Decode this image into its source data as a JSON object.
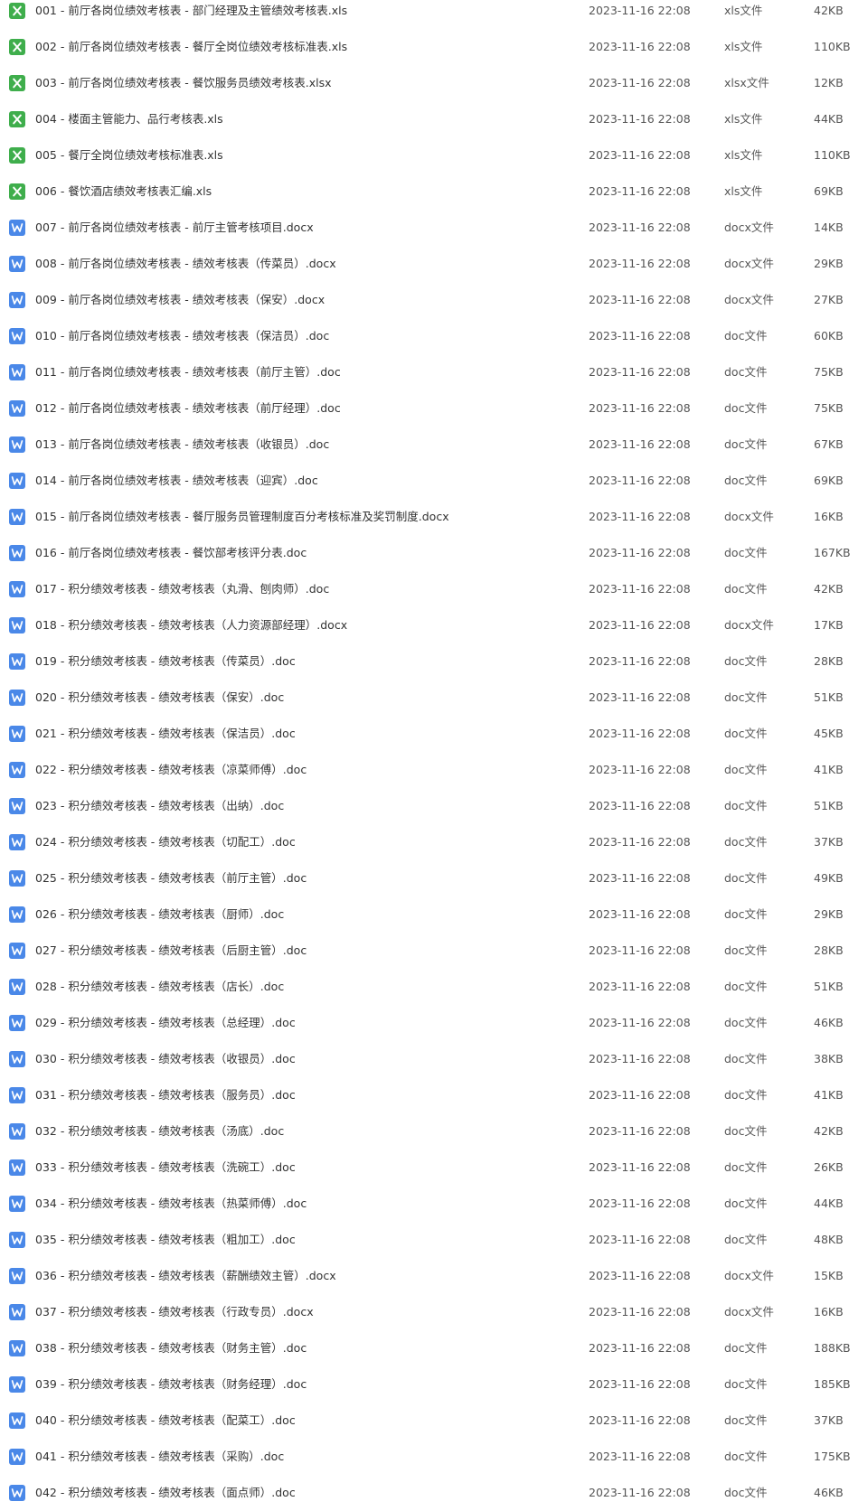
{
  "colors": {
    "xls_icon": "#3fae4c",
    "doc_icon": "#4a88e8",
    "text": "#333333",
    "background": "#ffffff"
  },
  "icons": {
    "xls": "excel-file-icon",
    "doc": "word-file-icon"
  },
  "files": [
    {
      "name": "001 - 前厅各岗位绩效考核表 - 部门经理及主管绩效考核表.xls",
      "date": "2023-11-16 22:08",
      "type": "xls文件",
      "size": "42KB",
      "icon": "xls"
    },
    {
      "name": "002 - 前厅各岗位绩效考核表 - 餐厅全岗位绩效考核标准表.xls",
      "date": "2023-11-16 22:08",
      "type": "xls文件",
      "size": "110KB",
      "icon": "xls"
    },
    {
      "name": "003 - 前厅各岗位绩效考核表 - 餐饮服务员绩效考核表.xlsx",
      "date": "2023-11-16 22:08",
      "type": "xlsx文件",
      "size": "12KB",
      "icon": "xls"
    },
    {
      "name": "004 - 楼面主管能力、品行考核表.xls",
      "date": "2023-11-16 22:08",
      "type": "xls文件",
      "size": "44KB",
      "icon": "xls"
    },
    {
      "name": "005 - 餐厅全岗位绩效考核标准表.xls",
      "date": "2023-11-16 22:08",
      "type": "xls文件",
      "size": "110KB",
      "icon": "xls"
    },
    {
      "name": "006 - 餐饮酒店绩效考核表汇编.xls",
      "date": "2023-11-16 22:08",
      "type": "xls文件",
      "size": "69KB",
      "icon": "xls"
    },
    {
      "name": "007 - 前厅各岗位绩效考核表 - 前厅主管考核项目.docx",
      "date": "2023-11-16 22:08",
      "type": "docx文件",
      "size": "14KB",
      "icon": "doc"
    },
    {
      "name": "008 - 前厅各岗位绩效考核表 - 绩效考核表（传菜员）.docx",
      "date": "2023-11-16 22:08",
      "type": "docx文件",
      "size": "29KB",
      "icon": "doc"
    },
    {
      "name": "009 - 前厅各岗位绩效考核表 - 绩效考核表（保安）.docx",
      "date": "2023-11-16 22:08",
      "type": "docx文件",
      "size": "27KB",
      "icon": "doc"
    },
    {
      "name": "010 - 前厅各岗位绩效考核表 - 绩效考核表（保洁员）.doc",
      "date": "2023-11-16 22:08",
      "type": "doc文件",
      "size": "60KB",
      "icon": "doc"
    },
    {
      "name": "011 - 前厅各岗位绩效考核表 - 绩效考核表（前厅主管）.doc",
      "date": "2023-11-16 22:08",
      "type": "doc文件",
      "size": "75KB",
      "icon": "doc"
    },
    {
      "name": "012 - 前厅各岗位绩效考核表 - 绩效考核表（前厅经理）.doc",
      "date": "2023-11-16 22:08",
      "type": "doc文件",
      "size": "75KB",
      "icon": "doc"
    },
    {
      "name": "013 - 前厅各岗位绩效考核表 - 绩效考核表（收银员）.doc",
      "date": "2023-11-16 22:08",
      "type": "doc文件",
      "size": "67KB",
      "icon": "doc"
    },
    {
      "name": "014 - 前厅各岗位绩效考核表 - 绩效考核表（迎宾）.doc",
      "date": "2023-11-16 22:08",
      "type": "doc文件",
      "size": "69KB",
      "icon": "doc"
    },
    {
      "name": "015 - 前厅各岗位绩效考核表 - 餐厅服务员管理制度百分考核标准及奖罚制度.docx",
      "date": "2023-11-16 22:08",
      "type": "docx文件",
      "size": "16KB",
      "icon": "doc"
    },
    {
      "name": "016 - 前厅各岗位绩效考核表 - 餐饮部考核评分表.doc",
      "date": "2023-11-16 22:08",
      "type": "doc文件",
      "size": "167KB",
      "icon": "doc"
    },
    {
      "name": "017 - 积分绩效考核表 - 绩效考核表（丸滑、刨肉师）.doc",
      "date": "2023-11-16 22:08",
      "type": "doc文件",
      "size": "42KB",
      "icon": "doc"
    },
    {
      "name": "018 - 积分绩效考核表 - 绩效考核表（人力资源部经理）.docx",
      "date": "2023-11-16 22:08",
      "type": "docx文件",
      "size": "17KB",
      "icon": "doc"
    },
    {
      "name": "019 - 积分绩效考核表 - 绩效考核表（传菜员）.doc",
      "date": "2023-11-16 22:08",
      "type": "doc文件",
      "size": "28KB",
      "icon": "doc"
    },
    {
      "name": "020 - 积分绩效考核表 - 绩效考核表（保安）.doc",
      "date": "2023-11-16 22:08",
      "type": "doc文件",
      "size": "51KB",
      "icon": "doc"
    },
    {
      "name": "021 - 积分绩效考核表 - 绩效考核表（保洁员）.doc",
      "date": "2023-11-16 22:08",
      "type": "doc文件",
      "size": "45KB",
      "icon": "doc"
    },
    {
      "name": "022 - 积分绩效考核表 - 绩效考核表（凉菜师傅）.doc",
      "date": "2023-11-16 22:08",
      "type": "doc文件",
      "size": "41KB",
      "icon": "doc"
    },
    {
      "name": "023 - 积分绩效考核表 - 绩效考核表（出纳）.doc",
      "date": "2023-11-16 22:08",
      "type": "doc文件",
      "size": "51KB",
      "icon": "doc"
    },
    {
      "name": "024 - 积分绩效考核表 - 绩效考核表（切配工）.doc",
      "date": "2023-11-16 22:08",
      "type": "doc文件",
      "size": "37KB",
      "icon": "doc"
    },
    {
      "name": "025 - 积分绩效考核表 - 绩效考核表（前厅主管）.doc",
      "date": "2023-11-16 22:08",
      "type": "doc文件",
      "size": "49KB",
      "icon": "doc"
    },
    {
      "name": "026 - 积分绩效考核表 - 绩效考核表（厨师）.doc",
      "date": "2023-11-16 22:08",
      "type": "doc文件",
      "size": "29KB",
      "icon": "doc"
    },
    {
      "name": "027 - 积分绩效考核表 - 绩效考核表（后厨主管）.doc",
      "date": "2023-11-16 22:08",
      "type": "doc文件",
      "size": "28KB",
      "icon": "doc"
    },
    {
      "name": "028 - 积分绩效考核表 - 绩效考核表（店长）.doc",
      "date": "2023-11-16 22:08",
      "type": "doc文件",
      "size": "51KB",
      "icon": "doc"
    },
    {
      "name": "029 - 积分绩效考核表 - 绩效考核表（总经理）.doc",
      "date": "2023-11-16 22:08",
      "type": "doc文件",
      "size": "46KB",
      "icon": "doc"
    },
    {
      "name": "030 - 积分绩效考核表 - 绩效考核表（收银员）.doc",
      "date": "2023-11-16 22:08",
      "type": "doc文件",
      "size": "38KB",
      "icon": "doc"
    },
    {
      "name": "031 - 积分绩效考核表 - 绩效考核表（服务员）.doc",
      "date": "2023-11-16 22:08",
      "type": "doc文件",
      "size": "41KB",
      "icon": "doc"
    },
    {
      "name": "032 - 积分绩效考核表 - 绩效考核表（汤底）.doc",
      "date": "2023-11-16 22:08",
      "type": "doc文件",
      "size": "42KB",
      "icon": "doc"
    },
    {
      "name": "033 - 积分绩效考核表 - 绩效考核表（洗碗工）.doc",
      "date": "2023-11-16 22:08",
      "type": "doc文件",
      "size": "26KB",
      "icon": "doc"
    },
    {
      "name": "034 - 积分绩效考核表 - 绩效考核表（热菜师傅）.doc",
      "date": "2023-11-16 22:08",
      "type": "doc文件",
      "size": "44KB",
      "icon": "doc"
    },
    {
      "name": "035 - 积分绩效考核表 - 绩效考核表（粗加工）.doc",
      "date": "2023-11-16 22:08",
      "type": "doc文件",
      "size": "48KB",
      "icon": "doc"
    },
    {
      "name": "036 - 积分绩效考核表 - 绩效考核表（薪酬绩效主管）.docx",
      "date": "2023-11-16 22:08",
      "type": "docx文件",
      "size": "15KB",
      "icon": "doc"
    },
    {
      "name": "037 - 积分绩效考核表 - 绩效考核表（行政专员）.docx",
      "date": "2023-11-16 22:08",
      "type": "docx文件",
      "size": "16KB",
      "icon": "doc"
    },
    {
      "name": "038 - 积分绩效考核表 - 绩效考核表（财务主管）.doc",
      "date": "2023-11-16 22:08",
      "type": "doc文件",
      "size": "188KB",
      "icon": "doc"
    },
    {
      "name": "039 - 积分绩效考核表 - 绩效考核表（财务经理）.doc",
      "date": "2023-11-16 22:08",
      "type": "doc文件",
      "size": "185KB",
      "icon": "doc"
    },
    {
      "name": "040 - 积分绩效考核表 - 绩效考核表（配菜工）.doc",
      "date": "2023-11-16 22:08",
      "type": "doc文件",
      "size": "37KB",
      "icon": "doc"
    },
    {
      "name": "041 - 积分绩效考核表 - 绩效考核表（采购）.doc",
      "date": "2023-11-16 22:08",
      "type": "doc文件",
      "size": "175KB",
      "icon": "doc"
    },
    {
      "name": "042 - 积分绩效考核表 - 绩效考核表（面点师）.doc",
      "date": "2023-11-16 22:08",
      "type": "doc文件",
      "size": "46KB",
      "icon": "doc"
    }
  ]
}
